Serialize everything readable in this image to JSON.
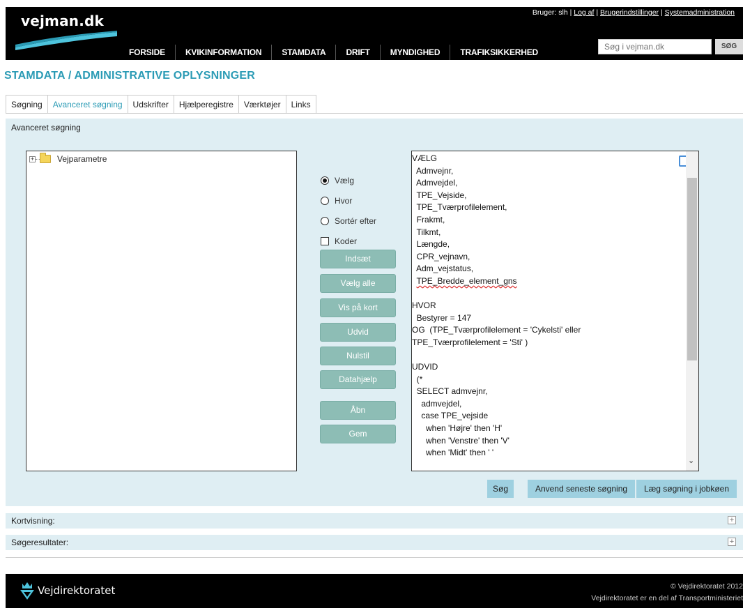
{
  "header": {
    "logo": "vejman.dk",
    "user_label": "Bruger: slh |",
    "logout": "Log af",
    "settings": "Brugerindstillinger",
    "sysadmin": "Systemadministration",
    "nav": [
      "FORSIDE",
      "KVIKINFORMATION",
      "STAMDATA",
      "DRIFT",
      "MYNDIGHED",
      "TRAFIKSIKKERHED"
    ],
    "search_placeholder": "Søg i vejman.dk",
    "search_button": "SØG"
  },
  "page_title": "STAMDATA / ADMINISTRATIVE OPLYSNINGER",
  "tabs": [
    "Søgning",
    "Avanceret søgning",
    "Udskrifter",
    "Hjælperegistre",
    "Værktøjer",
    "Links"
  ],
  "panel": {
    "title": "Avanceret søgning",
    "tree_root": "Vejparametre",
    "options": [
      "Vælg",
      "Hvor",
      "Sortér efter",
      "Koder"
    ],
    "buttons": [
      "Indsæt",
      "Vælg alle",
      "Vis på kort",
      "Udvid",
      "Nulstil",
      "Datahjælp",
      "Åbn",
      "Gem"
    ],
    "query_lines": [
      "VÆLG",
      "  Admvejnr,",
      "  Admvejdel,",
      "  TPE_Vejside,",
      "  TPE_Tværprofilelement,",
      "  Frakmt,",
      "  Tilkmt,",
      "  Længde,",
      "  CPR_vejnavn,",
      "  Adm_vejstatus,",
      "  TPE_Bredde_element_gns",
      "",
      "HVOR",
      "  Bestyrer = 147",
      "OG  (TPE_Tværprofilelement = 'Cykelsti' eller",
      "TPE_Tværprofilelement = 'Sti' )",
      "",
      "UDVID",
      "  (*",
      "  SELECT admvejnr,",
      "    admvejdel,",
      "    case TPE_vejside",
      "      when 'Højre' then 'H'",
      "      when 'Venstre' then 'V'",
      "      when 'Midt' then ' '"
    ],
    "actions": [
      "Søg",
      "Anvend seneste søgning",
      "Læg søgning i jobkøen"
    ]
  },
  "sections": [
    "Kortvisning:",
    "Søgeresultater:"
  ],
  "footer": {
    "logo": "Vejdirektoratet",
    "copyright": "© Vejdirektoratet 2012",
    "note": "Vejdirektoratet er en del af Transportministeriet"
  }
}
